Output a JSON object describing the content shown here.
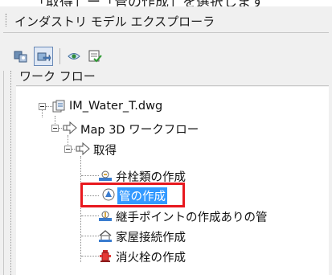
{
  "panel": {
    "title": "インダストリ モデル エクスプローラ"
  },
  "toolbar": {
    "buttons": [
      {
        "icon": "industry-model-icon"
      },
      {
        "icon": "workflow-view-icon"
      },
      {
        "icon": "eye-view-icon"
      },
      {
        "icon": "checklist-icon"
      }
    ]
  },
  "section": {
    "label": "ワーク フロー"
  },
  "tree": {
    "root": {
      "label": "IM_Water_T.dwg",
      "icon": "dwg-document-icon"
    },
    "workflow": {
      "label": "Map 3D ワークフロー",
      "icon": "workflow-arrow-icon"
    },
    "group": {
      "label": "取得",
      "icon": "workflow-arrow-icon"
    },
    "items": [
      {
        "label": "弁栓類の作成",
        "icon": "valve-icon"
      },
      {
        "label": "管の作成",
        "icon": "pipe-icon",
        "selected": true
      },
      {
        "label": "継手ポイントの作成ありの管",
        "icon": "joint-pipe-icon"
      },
      {
        "label": "家屋接続作成",
        "icon": "house-connection-icon"
      },
      {
        "label": "消火栓の作成",
        "icon": "hydrant-icon"
      }
    ]
  },
  "colors": {
    "selection": "#3399ff",
    "highlight": "#e8181e",
    "panel_bg": "#f0f0f0"
  }
}
